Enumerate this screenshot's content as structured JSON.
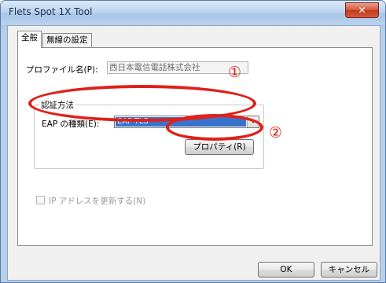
{
  "window": {
    "title": "Flets Spot 1X Tool",
    "close_glyph": "✕"
  },
  "tabs": [
    {
      "label": "全般"
    },
    {
      "label": "無線の設定"
    }
  ],
  "profile": {
    "label": "プロファイル名(P):",
    "value": "西日本電信電話株式会社"
  },
  "auth": {
    "group_title": "認証方法",
    "eap_label": "EAP の種類(E):",
    "eap_value": "EAP-TLS",
    "dropdown_glyph": "▾",
    "properties_button": "プロパティ(R)"
  },
  "ip_refresh": {
    "label": "IP アドレスを更新する(N)",
    "checked": false
  },
  "buttons": {
    "ok": "OK",
    "cancel": "キャンセル"
  },
  "annotations": {
    "marker1": "①",
    "marker2": "②",
    "color": "#e0201b"
  }
}
